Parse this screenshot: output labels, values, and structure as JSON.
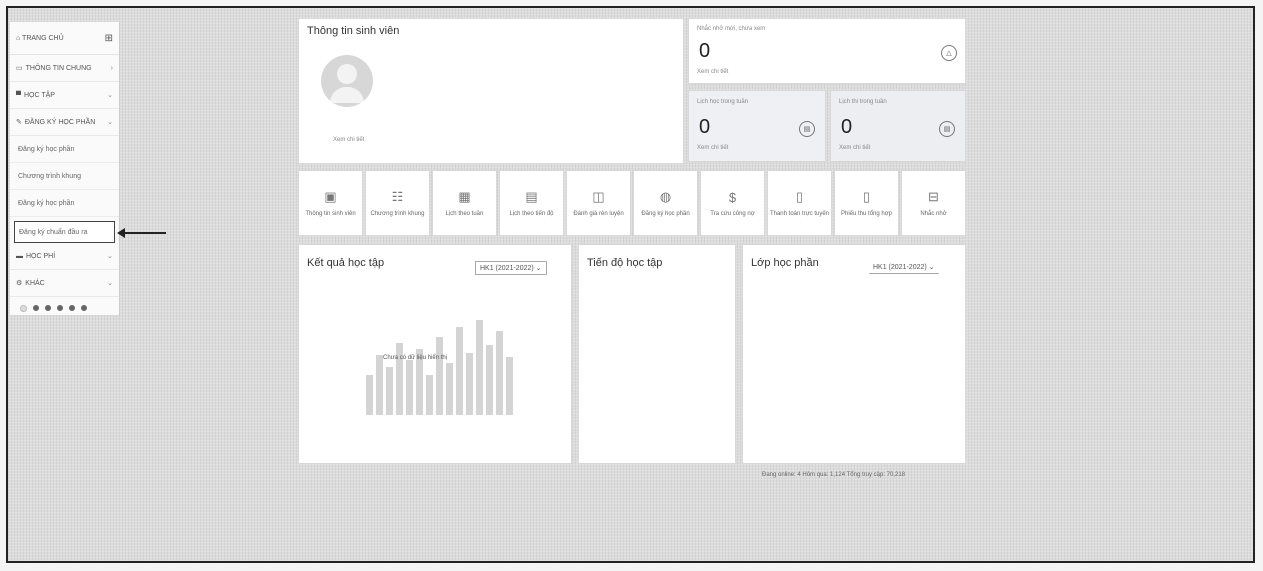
{
  "sidebar": {
    "home_label": "TRANG CHỦ",
    "items": [
      {
        "label": "THÔNG TIN CHUNG",
        "icon": "monitor-icon"
      },
      {
        "label": "HỌC TẬP",
        "icon": "graduation-icon"
      },
      {
        "label": "ĐĂNG KÝ HỌC PHẦN",
        "icon": "edit-icon"
      }
    ],
    "sub_items": [
      "Đăng ký học phần",
      "Chương trình khung",
      "Đăng ký học phần",
      "Đăng ký chuẩn đầu ra"
    ],
    "more_items": [
      {
        "label": "HỌC PHÍ",
        "icon": "card-icon"
      },
      {
        "label": "KHÁC",
        "icon": "gear-icon"
      }
    ]
  },
  "student_info": {
    "title": "Thông tin sinh viên",
    "detail_link": "Xem chi tiết"
  },
  "notifications": {
    "label": "Nhắc nhở mới, chưa xem",
    "count": "0",
    "link": "Xem chi tiết"
  },
  "stat_cards": [
    {
      "label": "Lịch học trong tuần",
      "count": "0",
      "link": "Xem chi tiết"
    },
    {
      "label": "Lịch thi trong tuần",
      "count": "0",
      "link": "Xem chi tiết"
    }
  ],
  "tiles": [
    {
      "label": "Thông tin sinh viên",
      "icon": "id-card-icon"
    },
    {
      "label": "Chương trình khung",
      "icon": "network-icon"
    },
    {
      "label": "Lịch theo tuần",
      "icon": "calendar-week-icon"
    },
    {
      "label": "Lịch theo tiến độ",
      "icon": "calendar-progress-icon"
    },
    {
      "label": "Đánh giá rèn luyện",
      "icon": "columns-icon"
    },
    {
      "label": "Đăng ký học phần",
      "icon": "globe-icon"
    },
    {
      "label": "Tra cứu công nợ",
      "icon": "dollar-icon"
    },
    {
      "label": "Thanh toán trực tuyến",
      "icon": "document-icon"
    },
    {
      "label": "Phiếu thu tổng hợp",
      "icon": "receipt-icon"
    },
    {
      "label": "Nhắc nhở",
      "icon": "inbox-icon"
    }
  ],
  "results": {
    "title": "Kết quả học tập",
    "term": "HK1 (2021-2022)",
    "no_data": "Chưa có dữ liệu hiển thị"
  },
  "progress": {
    "title": "Tiến độ học tập"
  },
  "classes": {
    "title": "Lớp học phần",
    "term": "HK1 (2021-2022)"
  },
  "footer": {
    "text": "Đang online: 4  Hôm qua: 1,124  Tổng truy cập: 70,218"
  }
}
